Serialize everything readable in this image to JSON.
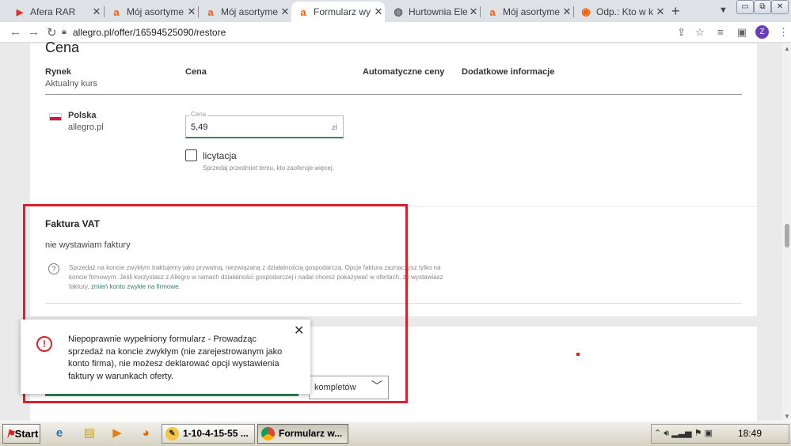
{
  "browser": {
    "tabs": [
      {
        "title": "Afera RAR",
        "icon": "youtube-icon",
        "color": "#e52d27",
        "glyph": "▶",
        "active": false
      },
      {
        "title": "Mój asortyme",
        "icon": "allegro-icon",
        "color": "#ff5a00",
        "glyph": "a",
        "active": false
      },
      {
        "title": "Mój asortyme",
        "icon": "allegro-icon",
        "color": "#ff5a00",
        "glyph": "a",
        "active": false
      },
      {
        "title": "Formularz wy",
        "icon": "allegro-icon",
        "color": "#ff5a00",
        "glyph": "a",
        "active": true
      },
      {
        "title": "Hurtownia Ele",
        "icon": "globe-icon",
        "color": "#5f6368",
        "glyph": "◍",
        "active": false
      },
      {
        "title": "Mój asortyme",
        "icon": "allegro-icon",
        "color": "#ff5a00",
        "glyph": "a",
        "active": false
      },
      {
        "title": "Odp.: Kto w k",
        "icon": "allegro-forum-icon",
        "color": "#ff5a00",
        "glyph": "◉",
        "active": false
      }
    ],
    "close_glyph": "✕",
    "new_tab": "+",
    "url": "allegro.pl/offer/16594525090/restore",
    "profile_initial": "Z"
  },
  "page": {
    "section_title": "Cena",
    "columns": {
      "market": "Rynek",
      "market_sub": "Aktualny kurs",
      "price": "Cena",
      "auto": "Automatyczne ceny",
      "extra": "Dodatkowe informacje"
    },
    "market": {
      "country": "Polska",
      "site": "allegro.pl"
    },
    "price_field": {
      "legend": "Cena",
      "value": "5,49",
      "unit": "zł"
    },
    "auction": {
      "label": "licytacja",
      "help": "Sprzedaj przedmiot temu, kto zaoferuje więcej."
    },
    "vat": {
      "title": "Faktura VAT",
      "value": "nie wystawiam faktury",
      "help_text": "Sprzedaż na koncie zwykłym traktujemy jako prywatną, niezwiązaną z działalnością gospodarczą. Opcje faktura zaznaczysz tylko na koncie firmowym. Jeśli korzystasz z Allegro w ramach działalności gospodarczej i nadal chcesz pokazywać w ofertach, że wystawiasz faktury,",
      "help_link": "zmień konto zwykłe na firmowe",
      "help_end": "."
    },
    "dropdown_label": "kompletów",
    "error": {
      "message": "Niepoprawnie wypełniony formularz - Prowadząc sprzedaż na koncie zwykłym (nie zarejestrowanym jako konto firma), nie możesz deklarować opcji wystawienia faktury w warunkach oferty.",
      "close": "✕",
      "icon": "!"
    }
  },
  "taskbar": {
    "start": "Start",
    "buttons": [
      {
        "label": "1-10-4-15-55 ...",
        "active": false
      },
      {
        "label": "Formularz w...",
        "active": true
      }
    ],
    "time": "18:49"
  }
}
